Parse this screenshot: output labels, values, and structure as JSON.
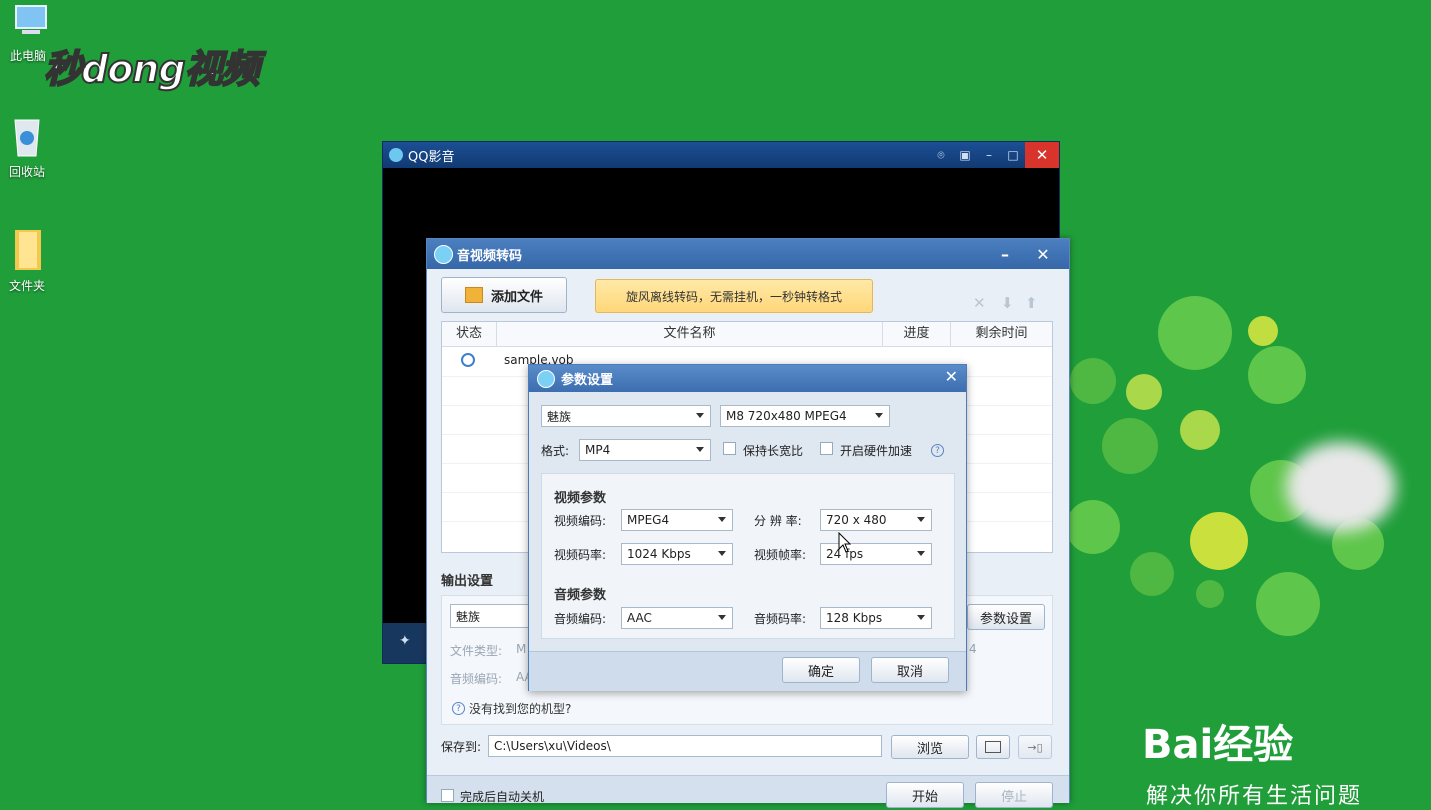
{
  "desktop": {
    "icons": [
      {
        "label": "此电脑",
        "icon": "computer-icon"
      },
      {
        "label": "回收站",
        "icon": "recycle-bin-icon"
      },
      {
        "label": "文件夹",
        "icon": "folder-icon"
      }
    ],
    "watermark_top": "秒dong视频",
    "watermark_bottom": "Bai经验",
    "watermark_bottom_sub": "解决你所有生活问题"
  },
  "qq_player": {
    "title": "QQ影音",
    "controls": [
      "pin-icon",
      "mini-icon",
      "minimize-icon",
      "maximize-icon",
      "close-icon"
    ]
  },
  "transcoder": {
    "title": "音视频转码",
    "add_file": "添加文件",
    "promo": "旋风离线转码，无需挂机，一秒钟转格式",
    "columns": [
      "状态",
      "文件名称",
      "进度",
      "剩余时间"
    ],
    "rows": [
      {
        "status_icon": "clock-icon",
        "name": "sample.vob",
        "progress": "",
        "remaining": ""
      }
    ],
    "output_title": "输出设置",
    "output_device": "魅族",
    "file_type_label": "文件类型:",
    "file_type_value": "M",
    "audio_codec_label": "音频编码:",
    "audio_codec_value": "AA",
    "side_value": "4",
    "params_button": "参数设置",
    "missing_model": "没有找到您的机型?",
    "save_to_label": "保存到:",
    "save_path": "C:\\Users\\xu\\Videos\\",
    "browse": "浏览",
    "auto_shutdown": "完成后自动关机",
    "start": "开始",
    "stop": "停止"
  },
  "params_dialog": {
    "title": "参数设置",
    "device": "魅族",
    "model": "M8 720x480 MPEG4",
    "format_label": "格式:",
    "format_value": "MP4",
    "keep_aspect": "保持长宽比",
    "hw_accel": "开启硬件加速",
    "video_section": "视频参数",
    "video_codec_label": "视频编码:",
    "video_codec": "MPEG4",
    "resolution_label": "分 辨 率:",
    "resolution": "720 x 480",
    "video_bitrate_label": "视频码率:",
    "video_bitrate": "1024 Kbps",
    "framerate_label": "视频帧率:",
    "framerate": "24 fps",
    "audio_section": "音频参数",
    "audio_codec_label": "音频编码:",
    "audio_codec": "AAC",
    "audio_bitrate_label": "音频码率:",
    "audio_bitrate": "128 Kbps",
    "ok": "确定",
    "cancel": "取消"
  }
}
